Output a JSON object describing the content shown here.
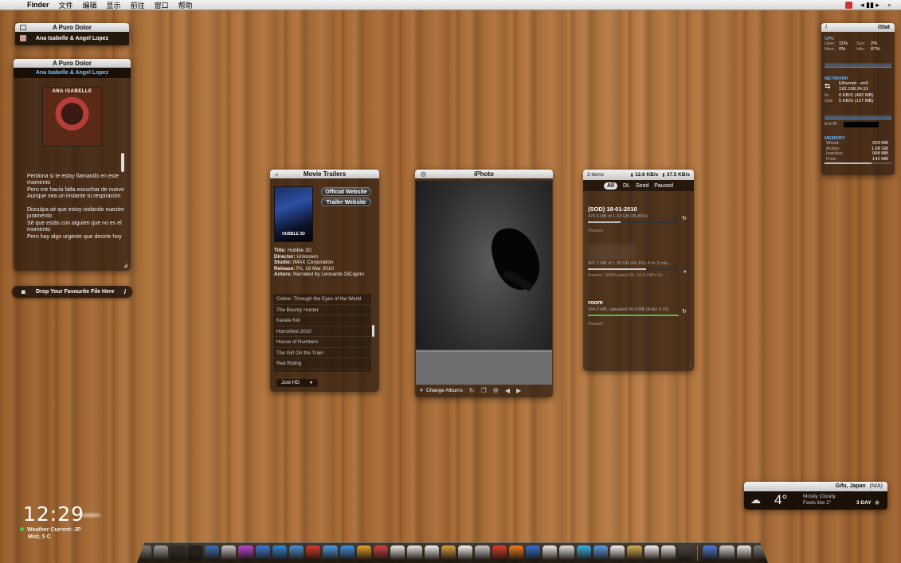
{
  "menubar": {
    "app": "Finder",
    "items": [
      "文件",
      "编辑",
      "显示",
      "前往",
      "窗口",
      "帮助"
    ]
  },
  "now_playing_small": {
    "title": "A Puro Dolor",
    "artist": "Ana Isabelle & Angel Lopez"
  },
  "now_playing": {
    "title": "A Puro Dolor",
    "artist": "Ana Isabelle & Angel Lopez",
    "cover_text": "ANA ISABELLE",
    "lyrics": "Perdona si te estoy llamando en este momento\nPero me hacía falta escuchar de nuevo\nAunque sea un instante tu respiración\n\nDisculpa sé que estoy violando nuestro juramento\nSé que estás con alguien que no es el momento\nPero hay algo urgente que decirte hoy"
  },
  "drop_bar": {
    "label": "Drop Your Favourite File Here",
    "info": "i"
  },
  "trailers": {
    "title": "Movie Trailers",
    "poster_text": "HUBBLE 3D",
    "official_btn": "Official Website",
    "trailer_btn": "Trailer Website",
    "details": [
      {
        "k": "Title:",
        "v": "Hubble 3D"
      },
      {
        "k": "Director:",
        "v": "Unknown"
      },
      {
        "k": "Studio:",
        "v": "IMAX Corporation"
      },
      {
        "k": "Release:",
        "v": "Fri, 19 Mar 2010"
      },
      {
        "k": "Actors:",
        "v": "Narrated by Leonardo DiCaprio"
      }
    ],
    "list": [
      "Celine: Through the Eyes of the World",
      "The Bounty Hunter",
      "Karate Kid",
      "Horrorfest 2010",
      "House of Numbers",
      "The Girl On the Train",
      "Red Riding"
    ],
    "quality": "Just HD"
  },
  "iphoto": {
    "title": "iPhoto",
    "change_albums": "Change Albums"
  },
  "torrent": {
    "items": "3 items",
    "down": "12.6 KB/s",
    "up": "37.5 KB/s",
    "tabs": [
      "All",
      "DL",
      "Seed",
      "Paused"
    ],
    "entries": [
      {
        "name": "(SOD) 18-01-2010",
        "meta": "470.6 MB of 1.33 GB (35.86%)",
        "status": "Paused",
        "progress": 0.36,
        "color": "#bbbbbb"
      },
      {
        "name": "",
        "meta": "897.1 MB of 1.38 GB (64.3%)- 6 hr 3 min...",
        "status": "Income: 28/90 peers DL: 12.6 KB/s UL: ...",
        "progress": 0.64,
        "color": "#cccccc"
      },
      {
        "name": "room",
        "meta": "284.0 MB, uploaded 99.3 MB (Ratio 0.33)",
        "status": "Paused",
        "progress": 1.0,
        "color": "#58b84a"
      }
    ]
  },
  "istat": {
    "title": "iStat",
    "cpu": {
      "head": "CPU",
      "user": "11%",
      "nice": "0%",
      "sys": "2%",
      "idle": "87%"
    },
    "network": {
      "head": "NETWORK",
      "iface": "Ethernet - en0",
      "ip": "192.168.24.51",
      "in": "6 KB/S (482 MB)",
      "out": "5 KB/S (127 MB)",
      "ext_ip_label": "Ext IP:"
    },
    "memory": {
      "head": "MEMORY",
      "wired": "209 MB",
      "active": "1.68 GB",
      "inactive": "998 MB",
      "free": "142 MB"
    }
  },
  "weather": {
    "location": "Gifu, Japan",
    "na": "(N/A)",
    "temp": "4°",
    "condition": "Mostly Cloudy",
    "feels": "Feels like 2°",
    "day": "3 DAY"
  },
  "clock": {
    "time": "12:29",
    "weather_line1": "Weather Current:  JP",
    "weather_line2": "Mist, 5 C"
  },
  "dock": {
    "colors": [
      "#7a7a7a",
      "#9a9a9a",
      "#2e2e2e",
      "#222222",
      "#3a6fb5",
      "#c5c5c5",
      "#bb44cc",
      "#3a7ad8",
      "#2f86d6",
      "#4a8fd8",
      "#d33a2a",
      "#4b9be0",
      "#3a90e0",
      "#e3a02a",
      "#d04040",
      "#e9e9e9",
      "#e5e5e5",
      "#f0f0f0",
      "#d8a040",
      "#f3f3f3",
      "#c8c8c8",
      "#e03a2a",
      "#f07a20",
      "#3070d0",
      "#eaeaea",
      "#dfdfdf",
      "#3ab0e8",
      "#5a9be8",
      "#f2f2f2",
      "#d4b050",
      "#f0f0f0",
      "#e2e2e2",
      "#444444",
      "#4a7ad8",
      "#d0d0d0",
      "#e8e8e8",
      "#7a7a7a"
    ]
  }
}
